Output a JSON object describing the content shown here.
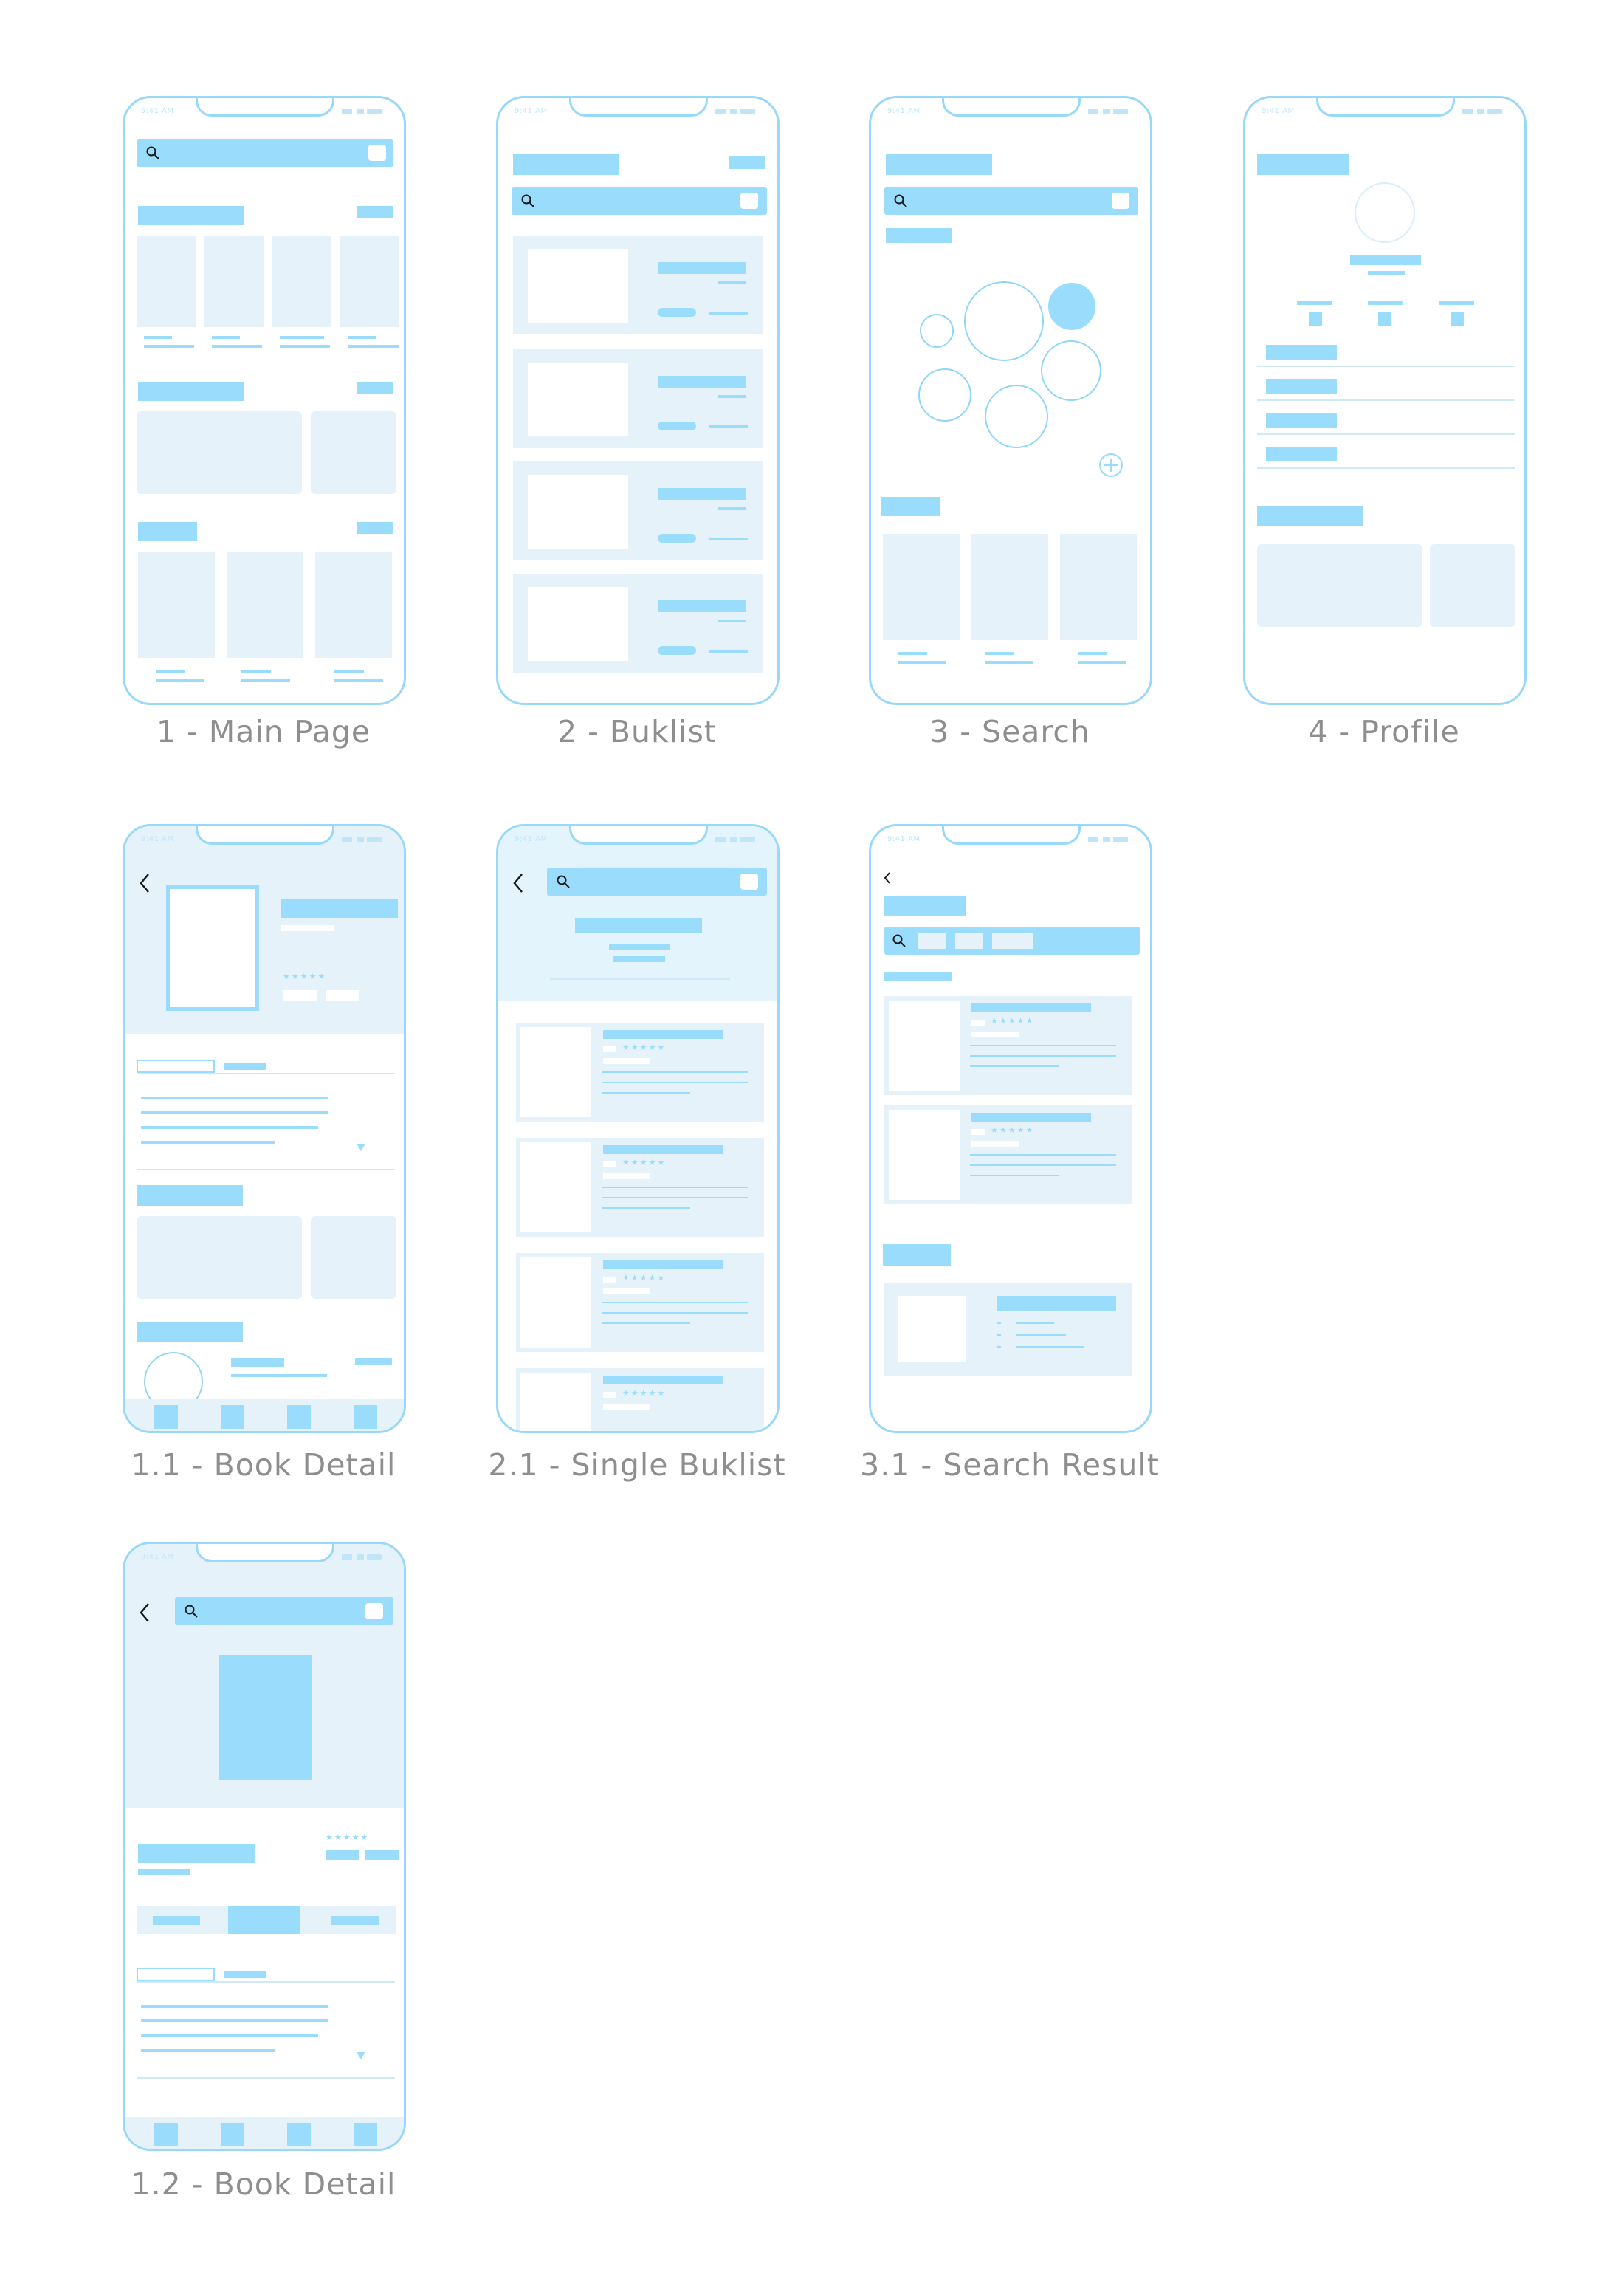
{
  "screens": [
    {
      "id": "1",
      "caption": "1 - Main Page"
    },
    {
      "id": "2",
      "caption": "2 - Buklist"
    },
    {
      "id": "3",
      "caption": "3 - Search"
    },
    {
      "id": "4",
      "caption": "4 - Profile"
    },
    {
      "id": "1.1",
      "caption": "1.1 - Book Detail"
    },
    {
      "id": "2.1",
      "caption": "2.1 - Single Buklist"
    },
    {
      "id": "3.1",
      "caption": "3.1 - Search Result"
    },
    {
      "id": "1.2",
      "caption": "1.2 - Book Detail"
    }
  ],
  "status_bar": {
    "time": "9:41 AM"
  },
  "star_rating": "★★★★★",
  "colors": {
    "accent": "#9adcfb",
    "border": "#98d8f8",
    "placeholder": "#e6f2fa",
    "caption": "#8e8e8e"
  },
  "icons": [
    "search-icon",
    "back-arrow-icon",
    "plus-circle-icon"
  ]
}
